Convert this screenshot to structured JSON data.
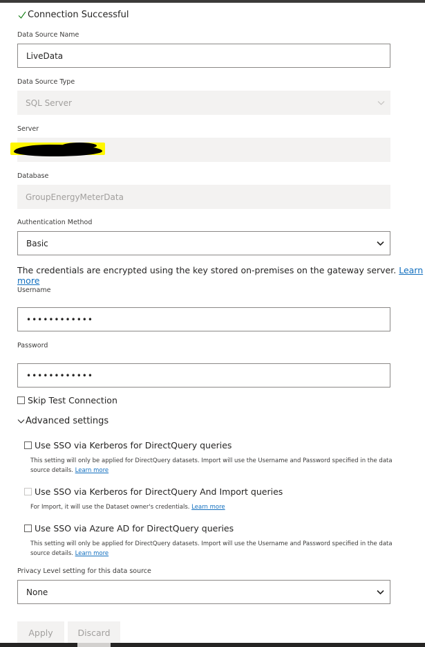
{
  "status": {
    "text": "Connection Successful"
  },
  "fields": {
    "data_source_name": {
      "label": "Data Source Name",
      "value": "LiveData"
    },
    "data_source_type": {
      "label": "Data Source Type",
      "value": "SQL Server"
    },
    "server": {
      "label": "Server",
      "value": ""
    },
    "database": {
      "label": "Database",
      "value": "GroupEnergyMeterData"
    },
    "auth_method": {
      "label": "Authentication Method",
      "value": "Basic"
    },
    "username": {
      "label": "Username",
      "value": "••••••••••••"
    },
    "password": {
      "label": "Password",
      "value": "••••••••••••"
    },
    "privacy_level": {
      "label": "Privacy Level setting for this data source",
      "value": "None"
    }
  },
  "credentials_info": {
    "text": "The credentials are encrypted using the key stored on-premises on the gateway server.",
    "link": "Learn more"
  },
  "skip_test": {
    "label": "Skip Test Connection"
  },
  "advanced": {
    "label": "Advanced settings",
    "options": [
      {
        "label": "Use SSO via Kerberos for DirectQuery queries",
        "desc": "This setting will only be applied for DirectQuery datasets. Import will use the Username and Password specified in the data source details.",
        "link": "Learn more"
      },
      {
        "label": "Use SSO via Kerberos for DirectQuery And Import queries",
        "desc": "For Import, it will use the Dataset owner's credentials.",
        "link": "Learn more"
      },
      {
        "label": "Use SSO via Azure AD for DirectQuery queries",
        "desc": "This setting will only be applied for DirectQuery datasets. Import will use the Username and Password specified in the data source details.",
        "link": "Learn more"
      }
    ]
  },
  "buttons": {
    "apply": "Apply",
    "discard": "Discard"
  },
  "colors": {
    "link": "#106ebe",
    "disabled_bg": "#f3f2f1",
    "disabled_text": "#a19f9d",
    "redaction_highlight": "#fff700"
  }
}
